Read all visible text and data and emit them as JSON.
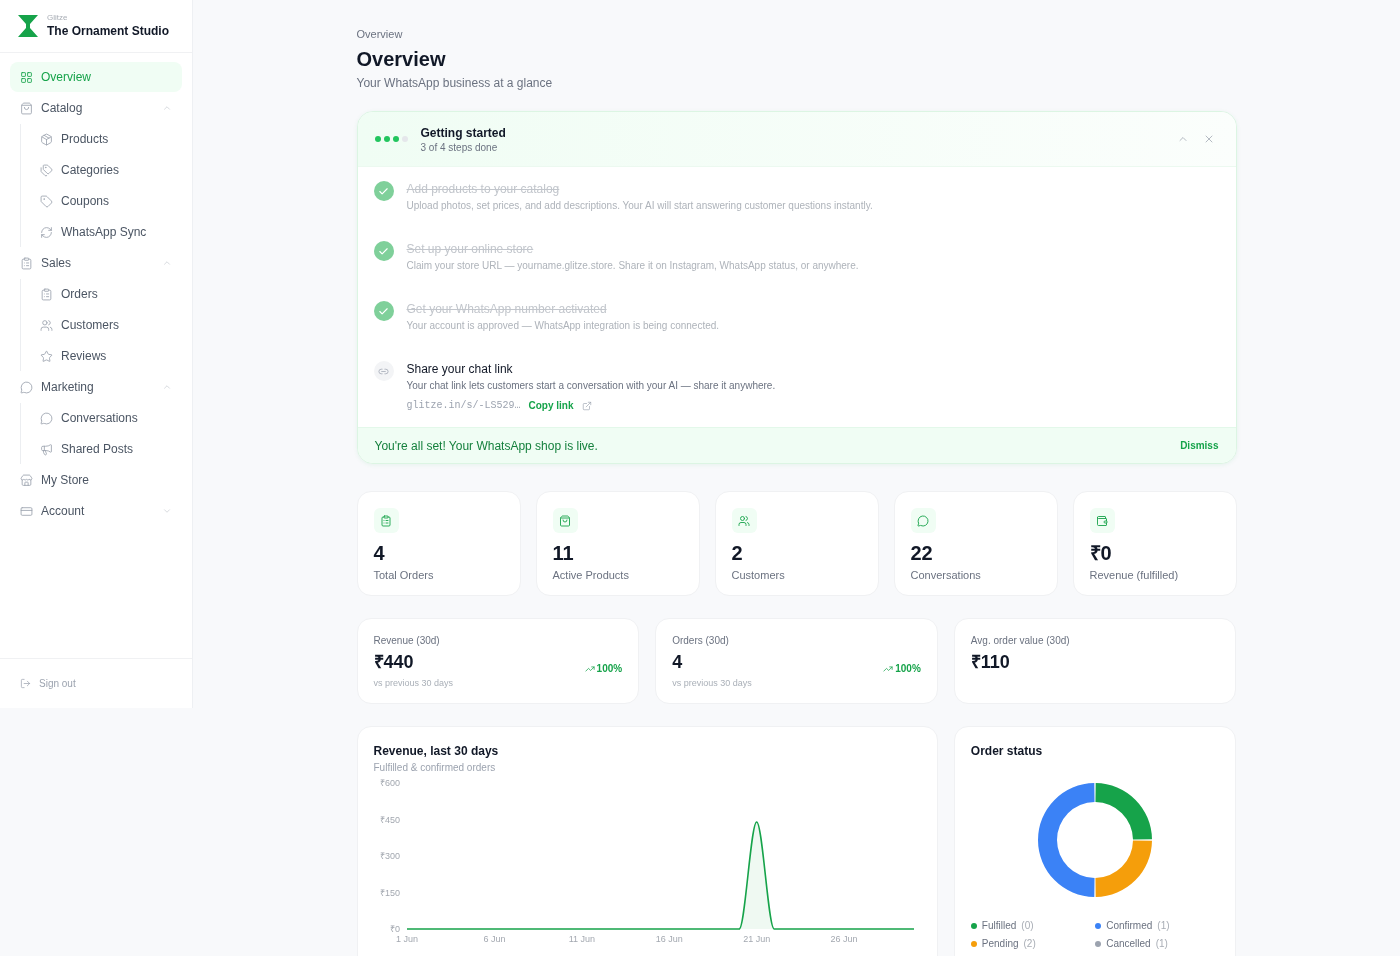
{
  "sidebar": {
    "brand": {
      "caption": "Glitze",
      "name": "The Ornament Studio"
    },
    "nav": [
      {
        "label": "Overview",
        "selected": true
      },
      {
        "label": "Catalog",
        "selected": false,
        "expanded": true,
        "children": [
          {
            "label": "Products",
            "selected": false
          },
          {
            "label": "Categories",
            "selected": false
          },
          {
            "label": "Coupons",
            "selected": false
          },
          {
            "label": "WhatsApp Sync",
            "selected": false
          }
        ]
      },
      {
        "label": "Sales",
        "selected": false,
        "expanded": true,
        "children": [
          {
            "label": "Orders",
            "selected": false
          },
          {
            "label": "Customers",
            "selected": false
          },
          {
            "label": "Reviews",
            "selected": false
          }
        ]
      },
      {
        "label": "Marketing",
        "selected": false,
        "expanded": true,
        "children": [
          {
            "label": "Conversations",
            "selected": false
          },
          {
            "label": "Shared Posts",
            "selected": false
          }
        ]
      },
      {
        "label": "My Store",
        "selected": false
      },
      {
        "label": "Account",
        "selected": false,
        "expanded": false
      }
    ],
    "sign_out": "Sign out"
  },
  "page": {
    "breadcrumb": "Overview",
    "title": "Overview",
    "subtitle": "Your WhatsApp business at a glance"
  },
  "getting_started": {
    "title": "Getting started",
    "progress": "3 of 4 steps done",
    "expanded": true,
    "steps": [
      {
        "title": "Add products to your catalog",
        "description": "Upload photos, set prices, and add descriptions. Your AI will start answering customer questions instantly.",
        "done": true
      },
      {
        "title": "Set up your online store",
        "description": "Claim your store URL — yourname.glitze.store. Share it on Instagram, WhatsApp status, or anywhere.",
        "done": true
      },
      {
        "title": "Get your WhatsApp number activated",
        "description": "Your account is approved — WhatsApp integration is being connected.",
        "done": true
      },
      {
        "title": "Share your chat link",
        "description": "Your chat link lets customers start a conversation with your AI — share it anywhere.",
        "done": false,
        "link": "glitze.in/s/-LS529…",
        "action": "Copy link"
      }
    ],
    "banner": "You're all set! Your WhatsApp shop is live.",
    "dismiss": "Dismiss"
  },
  "stats": [
    {
      "value": "4",
      "label": "Total Orders"
    },
    {
      "value": "11",
      "label": "Active Products"
    },
    {
      "value": "2",
      "label": "Customers"
    },
    {
      "value": "22",
      "label": "Conversations"
    },
    {
      "value": "₹0",
      "label": "Revenue (fulfilled)"
    }
  ],
  "trends": [
    {
      "label": "Revenue (30d)",
      "value": "₹440",
      "change": "100%",
      "note": "vs previous 30 days"
    },
    {
      "label": "Orders (30d)",
      "value": "4",
      "change": "100%",
      "note": "vs previous 30 days"
    },
    {
      "label": "Avg. order value (30d)",
      "value": "₹110"
    }
  ],
  "revenue_chart": {
    "title": "Revenue, last 30 days",
    "subtitle": "Fulfilled & confirmed orders",
    "chart_data": {
      "type": "area",
      "categories": [
        "1 Jun",
        null,
        null,
        null,
        null,
        "6 Jun",
        null,
        null,
        null,
        null,
        "11 Jun",
        null,
        null,
        null,
        null,
        "16 Jun",
        null,
        null,
        null,
        null,
        "21 Jun",
        null,
        null,
        null,
        null,
        "26 Jun",
        null,
        null,
        null,
        null
      ],
      "values": [
        0,
        0,
        0,
        0,
        0,
        0,
        0,
        0,
        0,
        0,
        0,
        0,
        0,
        0,
        0,
        0,
        0,
        0,
        0,
        0,
        440,
        0,
        0,
        0,
        0,
        0,
        0,
        0,
        0,
        0
      ],
      "ylim": [
        0,
        600
      ],
      "yticks": [
        {
          "value": 600,
          "label": "₹600"
        },
        {
          "value": 450,
          "label": "₹450"
        },
        {
          "value": 300,
          "label": "₹300"
        },
        {
          "value": 150,
          "label": "₹150"
        },
        {
          "value": 0,
          "label": "₹0"
        }
      ]
    }
  },
  "order_status": {
    "title": "Order status",
    "chart_data": {
      "type": "donut",
      "categories": [
        "Fulfilled",
        "Confirmed",
        "Pending",
        "Cancelled"
      ],
      "values": [
        25,
        50,
        25,
        0
      ],
      "legend": "bottom"
    },
    "legend": [
      {
        "count": "(0)",
        "color": "#16a34a"
      },
      {
        "count": "(1)",
        "color": "#3b82f6"
      },
      {
        "count": "(2)",
        "color": "#f59e0b"
      },
      {
        "count": "(1)",
        "color": "#9ca3af"
      }
    ]
  }
}
